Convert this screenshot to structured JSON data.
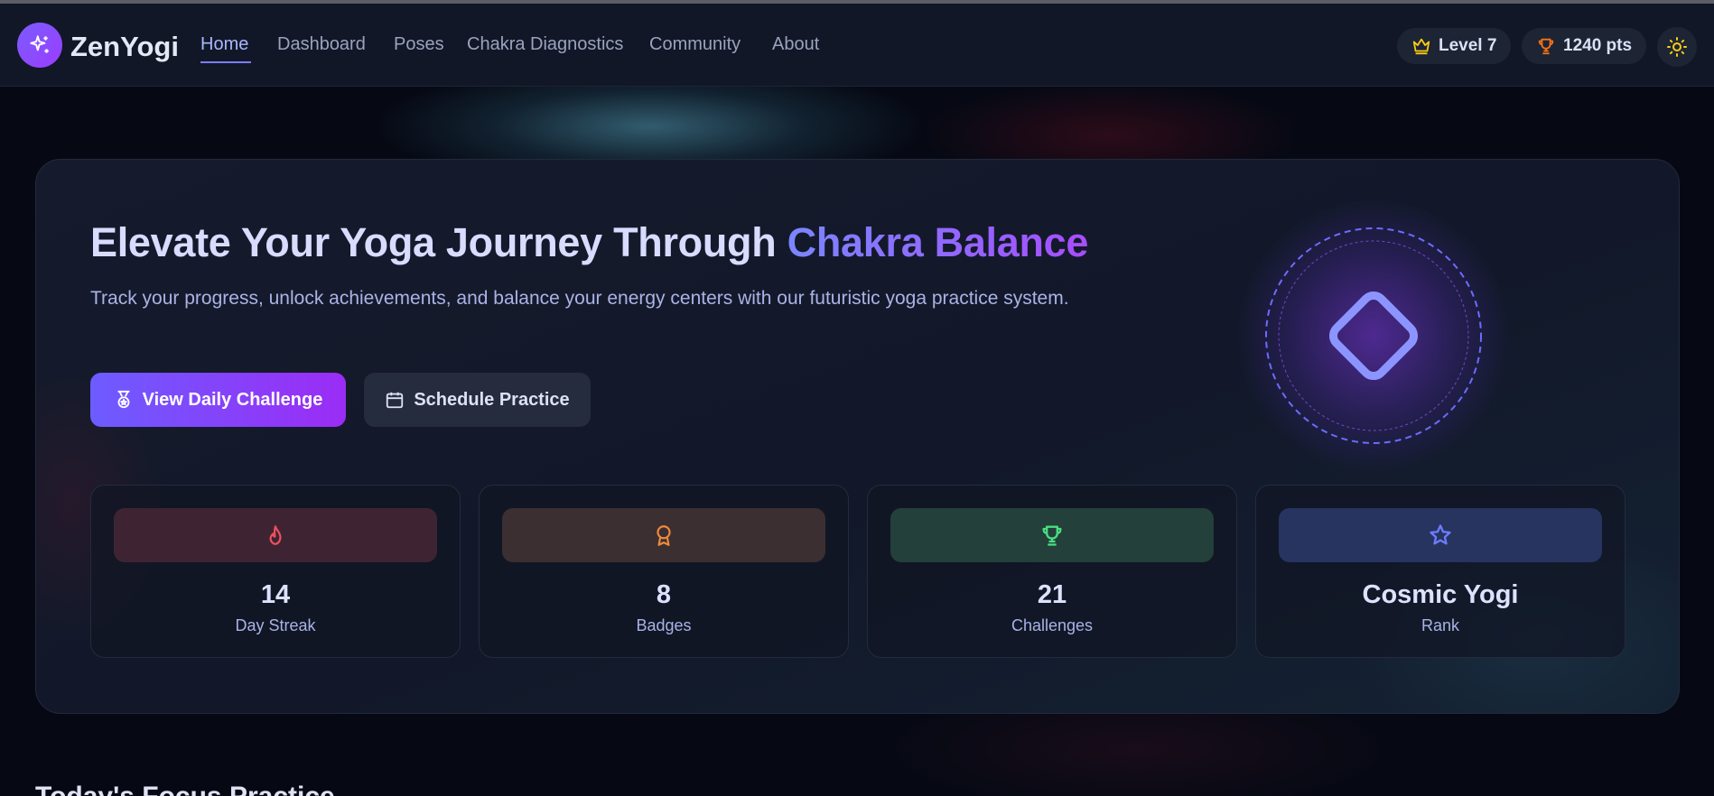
{
  "app": {
    "brand": "ZenYogi"
  },
  "nav": {
    "links": [
      "Home",
      "Dashboard",
      "Poses",
      "Chakra Diagnostics",
      "Community",
      "About"
    ],
    "active": "Home"
  },
  "header_right": {
    "level_label": "Level 7",
    "points_label": "1240 pts"
  },
  "hero": {
    "title_main": "Elevate Your Yoga Journey Through ",
    "title_accent": "Chakra Balance",
    "subtitle": "Track your progress, unlock achievements, and balance your energy centers with our futuristic yoga practice system.",
    "primary_button": "View Daily Challenge",
    "secondary_button": "Schedule Practice"
  },
  "stats": [
    {
      "value": "14",
      "label": "Day Streak",
      "icon": "flame-icon",
      "color": "#ef4f5e"
    },
    {
      "value": "8",
      "label": "Badges",
      "icon": "medal-icon",
      "color": "#f08a3c"
    },
    {
      "value": "21",
      "label": "Challenges",
      "icon": "trophy-icon",
      "color": "#4ade80"
    },
    {
      "value": "Cosmic Yogi",
      "label": "Rank",
      "icon": "star-icon",
      "color": "#6b7dff"
    }
  ],
  "next_section": {
    "heading": "Today's Focus Practice"
  },
  "colors": {
    "accent": "#7c6cff",
    "accent_purple": "#9b2cf5",
    "background": "#060914",
    "card": "#131a2b"
  }
}
